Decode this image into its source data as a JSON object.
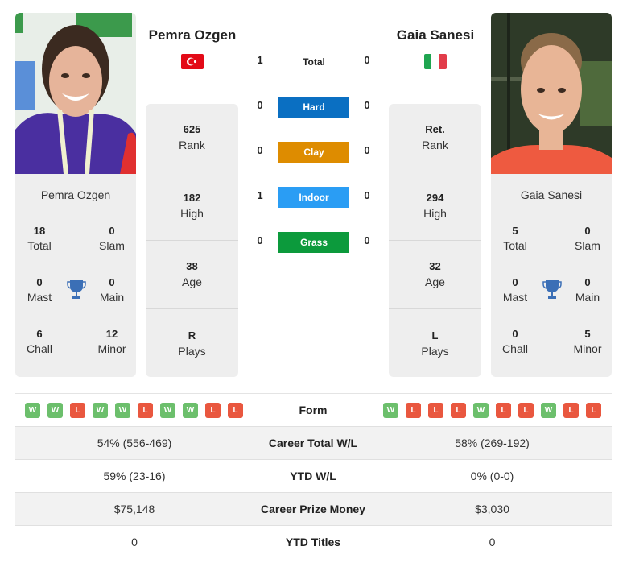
{
  "colors": {
    "hard": "#0a6fc2",
    "clay": "#de8c00",
    "indoor": "#2a9df4",
    "grass": "#0c9a3c",
    "win": "#6cbf6c",
    "loss": "#e9573f",
    "trophy": "#3b6fb6"
  },
  "player1": {
    "name": "Pemra Ozgen",
    "flag": "turkey-flag",
    "photo": "player-photo",
    "titles": {
      "total": {
        "value": "18",
        "label": "Total"
      },
      "slam": {
        "value": "0",
        "label": "Slam"
      },
      "mast": {
        "value": "0",
        "label": "Mast"
      },
      "main": {
        "value": "0",
        "label": "Main"
      },
      "chall": {
        "value": "6",
        "label": "Chall"
      },
      "minor": {
        "value": "12",
        "label": "Minor"
      }
    },
    "rank": {
      "value": "625",
      "label": "Rank"
    },
    "high": {
      "value": "182",
      "label": "High"
    },
    "age": {
      "value": "38",
      "label": "Age"
    },
    "plays": {
      "value": "R",
      "label": "Plays"
    },
    "form": [
      "W",
      "W",
      "L",
      "W",
      "W",
      "L",
      "W",
      "W",
      "L",
      "L"
    ],
    "career_wl": "54% (556-469)",
    "ytd_wl": "59% (23-16)",
    "prize_money": "$75,148",
    "ytd_titles": "0"
  },
  "player2": {
    "name": "Gaia Sanesi",
    "flag": "italy-flag",
    "photo": "player-photo",
    "titles": {
      "total": {
        "value": "5",
        "label": "Total"
      },
      "slam": {
        "value": "0",
        "label": "Slam"
      },
      "mast": {
        "value": "0",
        "label": "Mast"
      },
      "main": {
        "value": "0",
        "label": "Main"
      },
      "chall": {
        "value": "0",
        "label": "Chall"
      },
      "minor": {
        "value": "5",
        "label": "Minor"
      }
    },
    "rank": {
      "value": "Ret.",
      "label": "Rank"
    },
    "high": {
      "value": "294",
      "label": "High"
    },
    "age": {
      "value": "32",
      "label": "Age"
    },
    "plays": {
      "value": "L",
      "label": "Plays"
    },
    "form": [
      "W",
      "L",
      "L",
      "L",
      "W",
      "L",
      "L",
      "W",
      "L",
      "L"
    ],
    "career_wl": "58% (269-192)",
    "ytd_wl": "0% (0-0)",
    "prize_money": "$3,030",
    "ytd_titles": "0"
  },
  "h2h": {
    "total": {
      "label": "Total",
      "p1": "1",
      "p2": "0"
    },
    "hard": {
      "label": "Hard",
      "p1": "0",
      "p2": "0"
    },
    "clay": {
      "label": "Clay",
      "p1": "0",
      "p2": "0"
    },
    "indoor": {
      "label": "Indoor",
      "p1": "1",
      "p2": "0"
    },
    "grass": {
      "label": "Grass",
      "p1": "0",
      "p2": "0"
    }
  },
  "table": {
    "form_label": "Form",
    "career_wl_label": "Career Total W/L",
    "ytd_wl_label": "YTD W/L",
    "prize_label": "Career Prize Money",
    "ytd_titles_label": "YTD Titles"
  }
}
